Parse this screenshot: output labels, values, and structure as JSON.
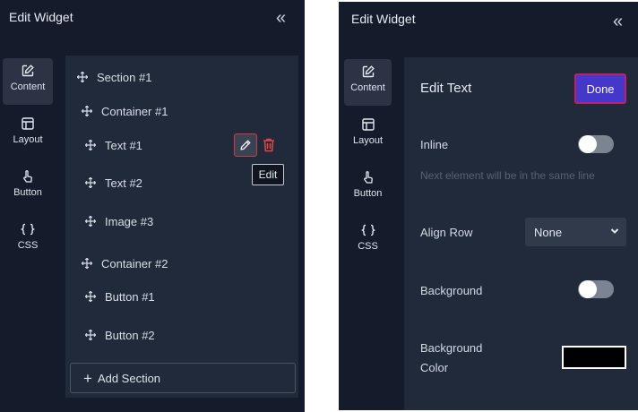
{
  "left_panel": {
    "title": "Edit Widget",
    "collapse_glyph": "«",
    "tabs": [
      {
        "label": "Content",
        "icon": "edit-square-icon",
        "active": true
      },
      {
        "label": "Layout",
        "icon": "layout-icon",
        "active": false
      },
      {
        "label": "Button",
        "icon": "pointer-hand-icon",
        "active": false
      },
      {
        "label": "CSS",
        "icon": "braces-icon",
        "active": false
      }
    ],
    "tree": [
      {
        "label": "Section #1",
        "level": 0
      },
      {
        "label": "Container #1",
        "level": 1
      },
      {
        "label": "Text #1",
        "level": 2,
        "selected": true
      },
      {
        "label": "Text #2",
        "level": 2
      },
      {
        "label": "Image #3",
        "level": 2
      },
      {
        "label": "Container #2",
        "level": 1
      },
      {
        "label": "Button #1",
        "level": 2
      },
      {
        "label": "Button #2",
        "level": 2
      }
    ],
    "tooltip": "Edit",
    "add_section": "Add Section"
  },
  "right_panel": {
    "title": "Edit Widget",
    "collapse_glyph": "«",
    "tabs": [
      {
        "label": "Content",
        "icon": "edit-square-icon",
        "active": true
      },
      {
        "label": "Layout",
        "icon": "layout-icon",
        "active": false
      },
      {
        "label": "Button",
        "icon": "pointer-hand-icon",
        "active": false
      },
      {
        "label": "CSS",
        "icon": "braces-icon",
        "active": false
      }
    ],
    "section_title": "Edit Text",
    "done": "Done",
    "inline_label": "Inline",
    "inline_on": false,
    "inline_hint": "Next element will be in the same line",
    "align_row_label": "Align Row",
    "align_row_value": "None",
    "background_label": "Background",
    "background_on": false,
    "background_color_label_line1": "Background",
    "background_color_label_line2": "Color",
    "background_color_value": "#000000"
  },
  "colors": {
    "panel_bg": "#141b2b",
    "content_bg": "#212a3b",
    "accent_button": "#4338ca",
    "delete_red": "#e04646"
  }
}
